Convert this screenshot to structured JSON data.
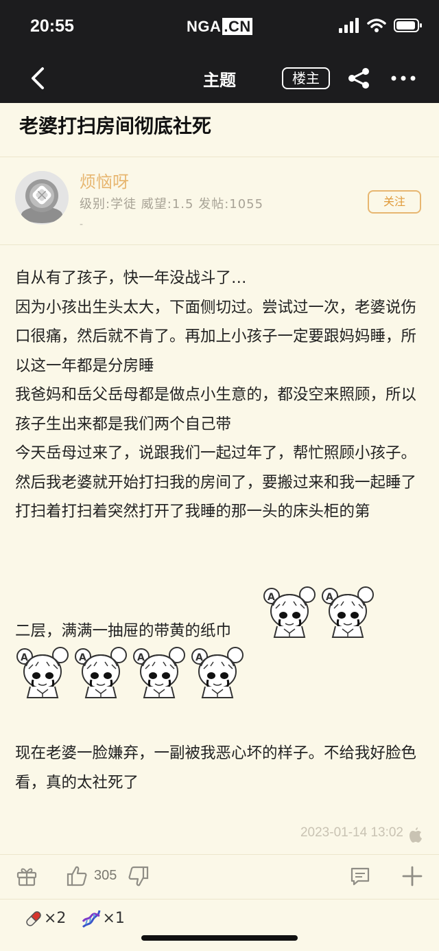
{
  "status_bar": {
    "time": "20:55",
    "app_logo_text": "NGA",
    "app_logo_suffix": ".CN",
    "icons": [
      "signal-icon",
      "wifi-icon",
      "battery-icon"
    ]
  },
  "nav": {
    "title": "主题",
    "op_badge": "楼主",
    "icons": [
      "back-icon",
      "share-icon",
      "more-icon"
    ]
  },
  "topic": {
    "title": "老婆打扫房间彻底社死"
  },
  "author": {
    "name": "烦恼呀",
    "stats": "级别:学徒  威望:1.5  发帖:1055",
    "extra": "-",
    "follow_label": "关注"
  },
  "post": {
    "lines": [
      "自从有了孩子，快一年没战斗了…",
      "因为小孩出生头太大，下面侧切过。尝试过一次，老婆说伤口很痛，然后就不肯了。再加上小孩子一定要跟妈妈睡，所以这一年都是分房睡",
      "我爸妈和岳父岳母都是做点小生意的，都没空来照顾，所以孩子生出来都是我们两个自己带",
      "今天岳母过来了，说跟我们一起过年了，帮忙照顾小孩子。",
      "然后我老婆就开始打扫我的房间了，要搬过来和我一起睡了",
      "打扫着打扫着突然打开了我睡的那一头的床头柜的第",
      "二层，满满一抽屉的带黄的纸巾",
      "现在老婆一脸嫌弃，一副被我恶心坏的样子。不给我好脸色看，真的太社死了"
    ],
    "sticker_count": 6,
    "timestamp": "2023-01-14 13:02"
  },
  "actions": {
    "like_count": "305",
    "icons": [
      "gift-icon",
      "thumbs-up-icon",
      "thumbs-down-icon",
      "comment-icon",
      "plus-icon"
    ]
  },
  "rewards": [
    {
      "icon": "pill-icon",
      "count": "×2"
    },
    {
      "icon": "dna-icon",
      "count": "×1"
    }
  ],
  "colors": {
    "background": "#fbf8e8",
    "header": "#1c1c1e",
    "author_name": "#e7b670",
    "follow": "#e09a3a",
    "meta_text": "#a8a396"
  }
}
